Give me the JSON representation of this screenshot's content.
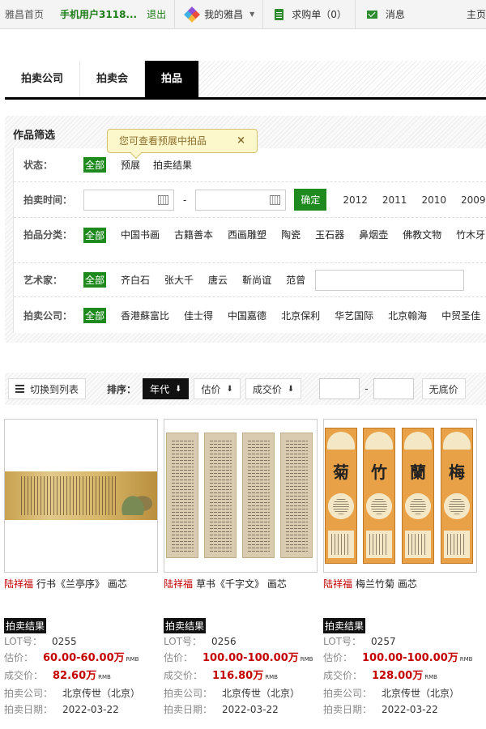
{
  "topbar": {
    "home": "雅昌首页",
    "user": "手机用户3118...",
    "logout": "退出",
    "my_artron": "我的雅昌",
    "cart": "求购单（0）",
    "messages": "消息",
    "home_right": "主页"
  },
  "tabs": [
    "拍卖公司",
    "拍卖会",
    "拍品"
  ],
  "filter": {
    "title": "作品筛选",
    "tooltip": "您可查看预展中拍品",
    "tooltip_close": "×",
    "status": {
      "label": "状态：",
      "options": [
        "全部",
        "预展",
        "拍卖结果"
      ]
    },
    "time": {
      "label": "拍卖时间：",
      "dash": "-",
      "confirm": "确定",
      "years": [
        "2012",
        "2011",
        "2010",
        "2009"
      ]
    },
    "category": {
      "label": "拍品分类：",
      "options": [
        "全部",
        "中国书画",
        "古籍善本",
        "西画雕塑",
        "陶瓷",
        "玉石器",
        "鼻烟壶",
        "佛教文物",
        "竹木牙"
      ]
    },
    "artist": {
      "label": "艺术家：",
      "options": [
        "全部",
        "齐白石",
        "张大千",
        "唐云",
        "靳尚谊",
        "范曾"
      ]
    },
    "company": {
      "label": "拍卖公司：",
      "options": [
        "全部",
        "香港蘇富比",
        "佳士得",
        "中国嘉德",
        "北京保利",
        "华艺国际",
        "北京翰海",
        "中贸圣佳"
      ]
    }
  },
  "sortbar": {
    "switch_list": "切换到列表",
    "sort_label": "排序：",
    "sorts": [
      "年代",
      "估价",
      "成交价"
    ],
    "price_dash": "-",
    "no_reserve": "无底价"
  },
  "lots": [
    {
      "artist": "陆祥福",
      "title": "行书《兰亭序》 画芯",
      "badge": "拍卖结果",
      "lot_label": "LOT号：",
      "lot": "0255",
      "est_label": "估价：",
      "est": "60.00-60.00",
      "est_unit": "万",
      "price_label": "成交价：",
      "price": "82.60",
      "price_unit": "万",
      "rmb": "RMB",
      "company_label": "拍卖公司：",
      "company": "北京传世（北京）",
      "date_label": "拍卖日期：",
      "date": "2022-03-22"
    },
    {
      "artist": "陆祥福",
      "title": "草书《千字文》 画芯",
      "badge": "拍卖结果",
      "lot_label": "LOT号：",
      "lot": "0256",
      "est_label": "估价：",
      "est": "100.00-100.00",
      "est_unit": "万",
      "price_label": "成交价：",
      "price": "116.80",
      "price_unit": "万",
      "rmb": "RMB",
      "company_label": "拍卖公司：",
      "company": "北京传世（北京）",
      "date_label": "拍卖日期：",
      "date": "2022-03-22"
    },
    {
      "artist": "陆祥福",
      "title": "梅兰竹菊 画芯",
      "badge": "拍卖结果",
      "lot_label": "LOT号：",
      "lot": "0257",
      "est_label": "估价：",
      "est": "100.00-100.00",
      "est_unit": "万",
      "price_label": "成交价：",
      "price": "128.00",
      "price_unit": "万",
      "rmb": "RMB",
      "company_label": "拍卖公司：",
      "company": "北京传世（北京）",
      "date_label": "拍卖日期：",
      "date": "2022-03-22",
      "panel_chars": [
        "菊",
        "竹",
        "蘭",
        "梅"
      ]
    }
  ],
  "colors": {
    "accent_green": "#1e8a1e",
    "price_red": "#c40000",
    "tab_active": "#000000"
  }
}
